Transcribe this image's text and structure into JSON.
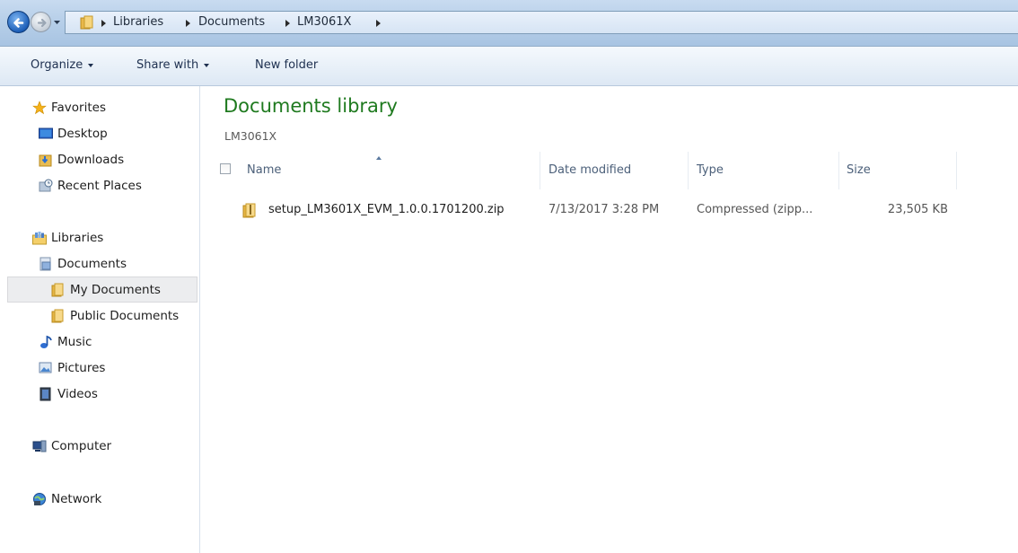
{
  "address_bar": {
    "breadcrumbs": [
      "Libraries",
      "Documents",
      "LM3061X"
    ]
  },
  "toolbar": {
    "organize": "Organize",
    "share_with": "Share with",
    "new_folder": "New folder"
  },
  "nav": {
    "favorites": "Favorites",
    "desktop": "Desktop",
    "downloads": "Downloads",
    "recent_places": "Recent Places",
    "libraries": "Libraries",
    "documents": "Documents",
    "my_documents": "My Documents",
    "public_documents": "Public Documents",
    "music": "Music",
    "pictures": "Pictures",
    "videos": "Videos",
    "computer": "Computer",
    "network": "Network"
  },
  "content": {
    "title": "Documents library",
    "subtitle": "LM3061X",
    "columns": [
      "Name",
      "Date modified",
      "Type",
      "Size"
    ],
    "files": [
      {
        "name": "setup_LM3601X_EVM_1.0.0.1701200.zip",
        "date_modified": "7/13/2017 3:28 PM",
        "type": "Compressed (zipp...",
        "size": "23,505 KB"
      }
    ]
  },
  "colors": {
    "title_green": "#1f7a1f",
    "header_text": "#4c607a",
    "selection": "#ecedef"
  }
}
